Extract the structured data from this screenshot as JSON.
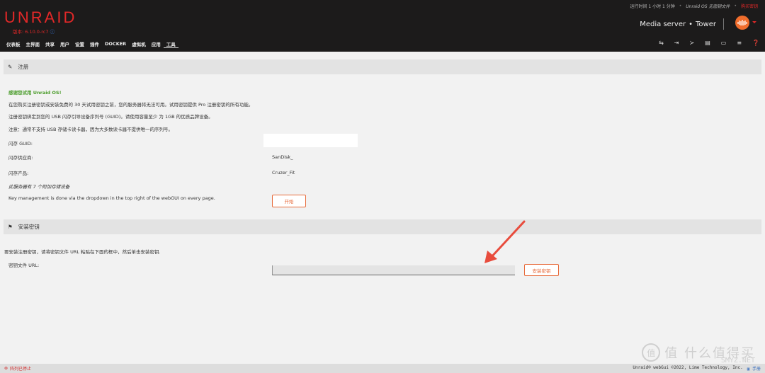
{
  "header": {
    "logo": "UNRAID",
    "version_label": "版本: 6.10.0-rc7",
    "uptime": "运行时间 1 小时 1 分钟",
    "os_status": "Unraid OS 无密钥文件",
    "buy_link": "购买密钥",
    "server_name": "Media server",
    "server_dot": "•",
    "server_host": "Tower"
  },
  "nav": {
    "items": [
      "仪表板",
      "主界面",
      "共享",
      "用户",
      "设置",
      "插件",
      "DOCKER",
      "虚拟机",
      "应用",
      "工具"
    ],
    "active": "工具",
    "icons": [
      "terminal-icon",
      "logout-icon",
      "console-icon",
      "clipboard-icon",
      "monitor-icon",
      "log-icon",
      "help-icon"
    ]
  },
  "registration": {
    "title": "注册",
    "thanks": "感谢您试用 Unraid OS!",
    "line1": "在您购买注册密钥或安装免费的 30 天试用密钥之前，您的服务器将无法可用。试用密钥提供 Pro 注册密钥的所有功能。",
    "line2": "注册密钥绑定到您的 USB 闪存引导设备序列号 (GUID)。请使用容量至少 为 1GB 的优质品牌设备。",
    "line3": "注意：通常不支持 USB 存储卡读卡器，因为大多数读卡器不提供唯一的序列号。",
    "guid_label": "闪存 GUID:",
    "guid_value": "",
    "vendor_label": "闪存供应商:",
    "vendor_value": "SanDisk_",
    "product_label": "闪存产品:",
    "product_value": "Cruzer_Fit",
    "attached": "此服务器有 7 个附加存储设备",
    "key_management": "Key management is done via the dropdown in the top right of the webGUI on every page.",
    "start_button": "开始"
  },
  "install_key": {
    "title": "安装密钥",
    "instructions": "要安装注册密钥，请将密钥文件 URL 粘贴在下面的框中，然后单击安装密钥.",
    "url_label": "密钥文件 URL:",
    "url_value": "",
    "install_button": "安装密钥"
  },
  "footer": {
    "array_status": "阵列已停止",
    "copyright": "Unraid® webGui ©2022, Lime Technology, Inc.",
    "manual": "手册"
  },
  "watermark": {
    "text": "值 什么值得买",
    "site": "SMYZ.NET"
  },
  "colors": {
    "brand": "#e22828",
    "accent_orange": "#e76a3a",
    "header_bg": "#1c1b1b",
    "green_text": "#4a9c2a"
  }
}
